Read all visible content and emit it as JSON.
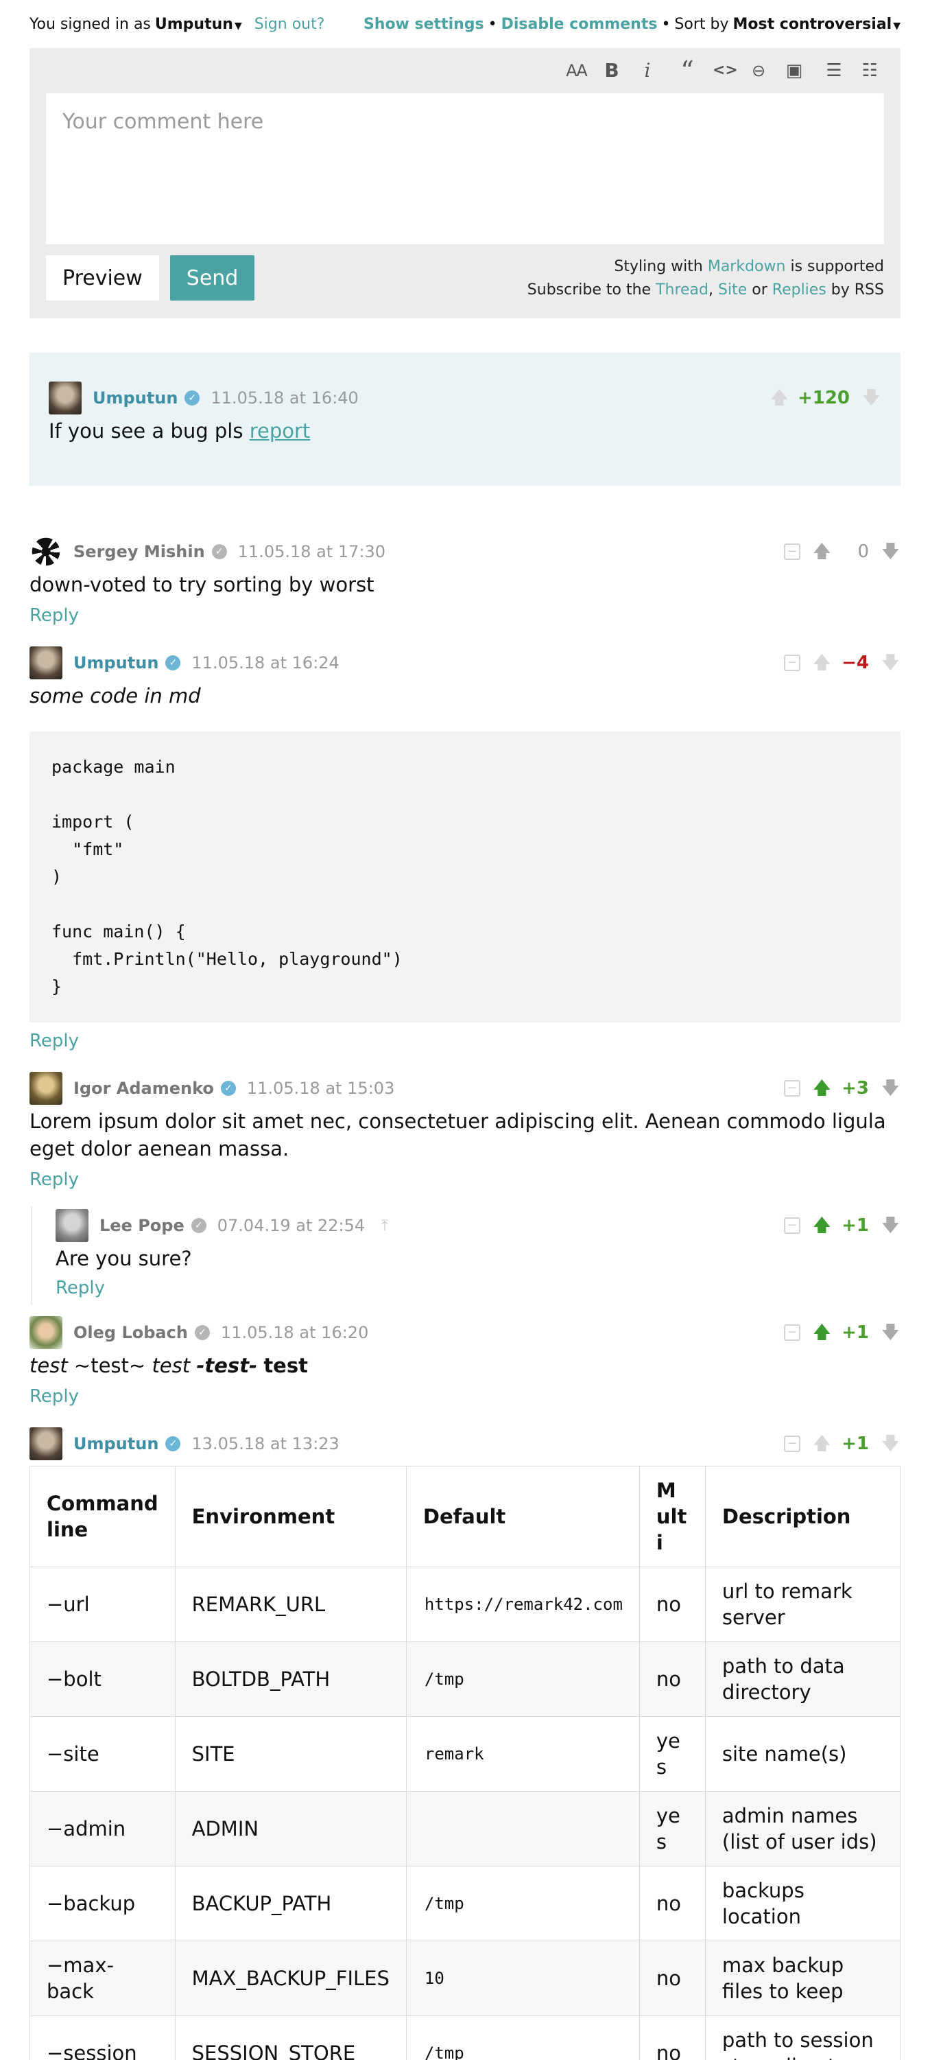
{
  "topbar": {
    "signed_in_prefix": "You signed in as",
    "user": "Umputun",
    "sign_out": "Sign out?",
    "show_settings": "Show settings",
    "separator": "•",
    "disable_comments": "Disable comments",
    "sort_by_label": "Sort by",
    "sort_value": "Most controversial"
  },
  "editor": {
    "placeholder": "Your comment here",
    "preview": "Preview",
    "send": "Send",
    "styling_prefix": "Styling with",
    "markdown": "Markdown",
    "styling_suffix": "is supported",
    "subscribe_prefix": "Subscribe to the",
    "thread": "Thread",
    "comma": ",",
    "site": "Site",
    "or": "or",
    "replies": "Replies",
    "by_rss": "by RSS"
  },
  "comments": {
    "pinned": {
      "author": "Umputun",
      "time": "11.05.18 at 16:40",
      "score": "+120",
      "text_prefix": "If you see a bug pls",
      "link": "report"
    },
    "c1": {
      "author": "Sergey Mishin",
      "time": "11.05.18 at 17:30",
      "score": "0",
      "text": "down-voted to try sorting by worst",
      "reply": "Reply"
    },
    "c2": {
      "author": "Umputun",
      "time": "11.05.18 at 16:24",
      "score": "−4",
      "text": "some code in md",
      "code": "package main\n\nimport (\n  \"fmt\"\n)\n\nfunc main() {\n  fmt.Println(\"Hello, playground\")\n}",
      "reply": "Reply"
    },
    "c3": {
      "author": "Igor Adamenko",
      "time": "11.05.18 at 15:03",
      "score": "+3",
      "text": "Lorem ipsum dolor sit amet nec, consectetuer adipiscing elit. Aenean commodo ligula eget dolor aenean massa.",
      "reply": "Reply"
    },
    "c4": {
      "author": "Lee Pope",
      "time": "07.04.19 at 22:54",
      "score": "+1",
      "text": "Are you sure?",
      "reply": "Reply"
    },
    "c5": {
      "author": "Oleg Lobach",
      "time": "11.05.18 at 16:20",
      "score": "+1",
      "t1": "test",
      "t2": "~test~",
      "t3": "test",
      "t4": "-test-",
      "t5": "test",
      "reply": "Reply"
    },
    "c6": {
      "author": "Umputun",
      "time": "13.05.18 at 13:23",
      "score": "+1",
      "table": {
        "headers": [
          "Command line",
          "Environment",
          "Default",
          "Multi",
          "Description"
        ],
        "rows": [
          [
            "−url",
            "REMARK_URL",
            "https://remark42.com",
            "no",
            "url to remark server"
          ],
          [
            "−bolt",
            "BOLTDB_PATH",
            "/tmp",
            "no",
            "path to data directory"
          ],
          [
            "−site",
            "SITE",
            "remark",
            "yes",
            "site name(s)"
          ],
          [
            "−admin",
            "ADMIN",
            "",
            "yes",
            "admin names (list of user ids)"
          ],
          [
            "−backup",
            "BACKUP_PATH",
            "/tmp",
            "no",
            "backups location"
          ],
          [
            "−max-back",
            "MAX_BACKUP_FILES",
            "10",
            "no",
            "max backup files to keep"
          ],
          [
            "−session",
            "SESSION_STORE",
            "/tmp",
            "no",
            "path to session store directory"
          ]
        ]
      }
    }
  }
}
